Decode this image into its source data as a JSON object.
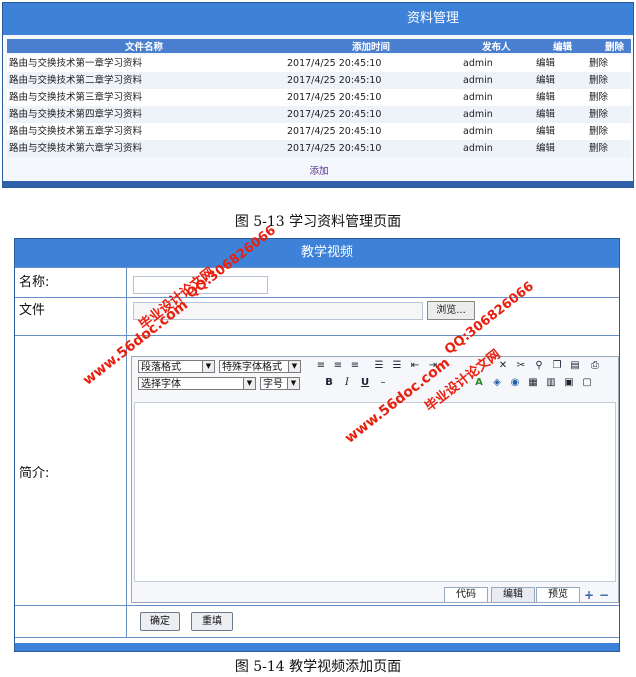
{
  "resource_panel": {
    "title": "资料管理",
    "columns": [
      "文件名称",
      "添加时间",
      "发布人",
      "编辑",
      "删除"
    ],
    "rows": [
      {
        "name": "路由与交换技术第一章学习资料",
        "time": "2017/4/25 20:45:10",
        "publisher": "admin",
        "edit": "编辑",
        "delete": "删除"
      },
      {
        "name": "路由与交换技术第二章学习资料",
        "time": "2017/4/25 20:45:10",
        "publisher": "admin",
        "edit": "编辑",
        "delete": "删除"
      },
      {
        "name": "路由与交换技术第三章学习资料",
        "time": "2017/4/25 20:45:10",
        "publisher": "admin",
        "edit": "编辑",
        "delete": "删除"
      },
      {
        "name": "路由与交换技术第四章学习资料",
        "time": "2017/4/25 20:45:10",
        "publisher": "admin",
        "edit": "编辑",
        "delete": "删除"
      },
      {
        "name": "路由与交换技术第五章学习资料",
        "time": "2017/4/25 20:45:10",
        "publisher": "admin",
        "edit": "编辑",
        "delete": "删除"
      },
      {
        "name": "路由与交换技术第六章学习资料",
        "time": "2017/4/25 20:45:10",
        "publisher": "admin",
        "edit": "编辑",
        "delete": "删除"
      }
    ],
    "add_link": "添加"
  },
  "caption1": "图 5-13 学习资料管理页面",
  "video_form": {
    "title": "教学视频",
    "name_label": "名称:",
    "file_label": "文件",
    "browse_label": "浏览...",
    "intro_label": "简介:",
    "editor": {
      "paragraph_format": "段落格式",
      "special_format": "特殊字体格式",
      "font_select": "选择字体",
      "font_size": "字号",
      "tab_code": "代码",
      "tab_edit": "编辑",
      "tab_preview": "预览"
    },
    "confirm_label": "确定",
    "reset_label": "重填"
  },
  "caption2": "图 5-14 教学视频添加页面",
  "watermarks": {
    "site": "www.56doc.com",
    "qq": "QQ:306826066",
    "brand": "毕业设计论文网"
  },
  "colors": {
    "header_blue": "#3d82d8",
    "column_header_blue": "#4a7fd0",
    "border_blue": "#2a5c9a",
    "watermark_red": "#e8200f"
  }
}
